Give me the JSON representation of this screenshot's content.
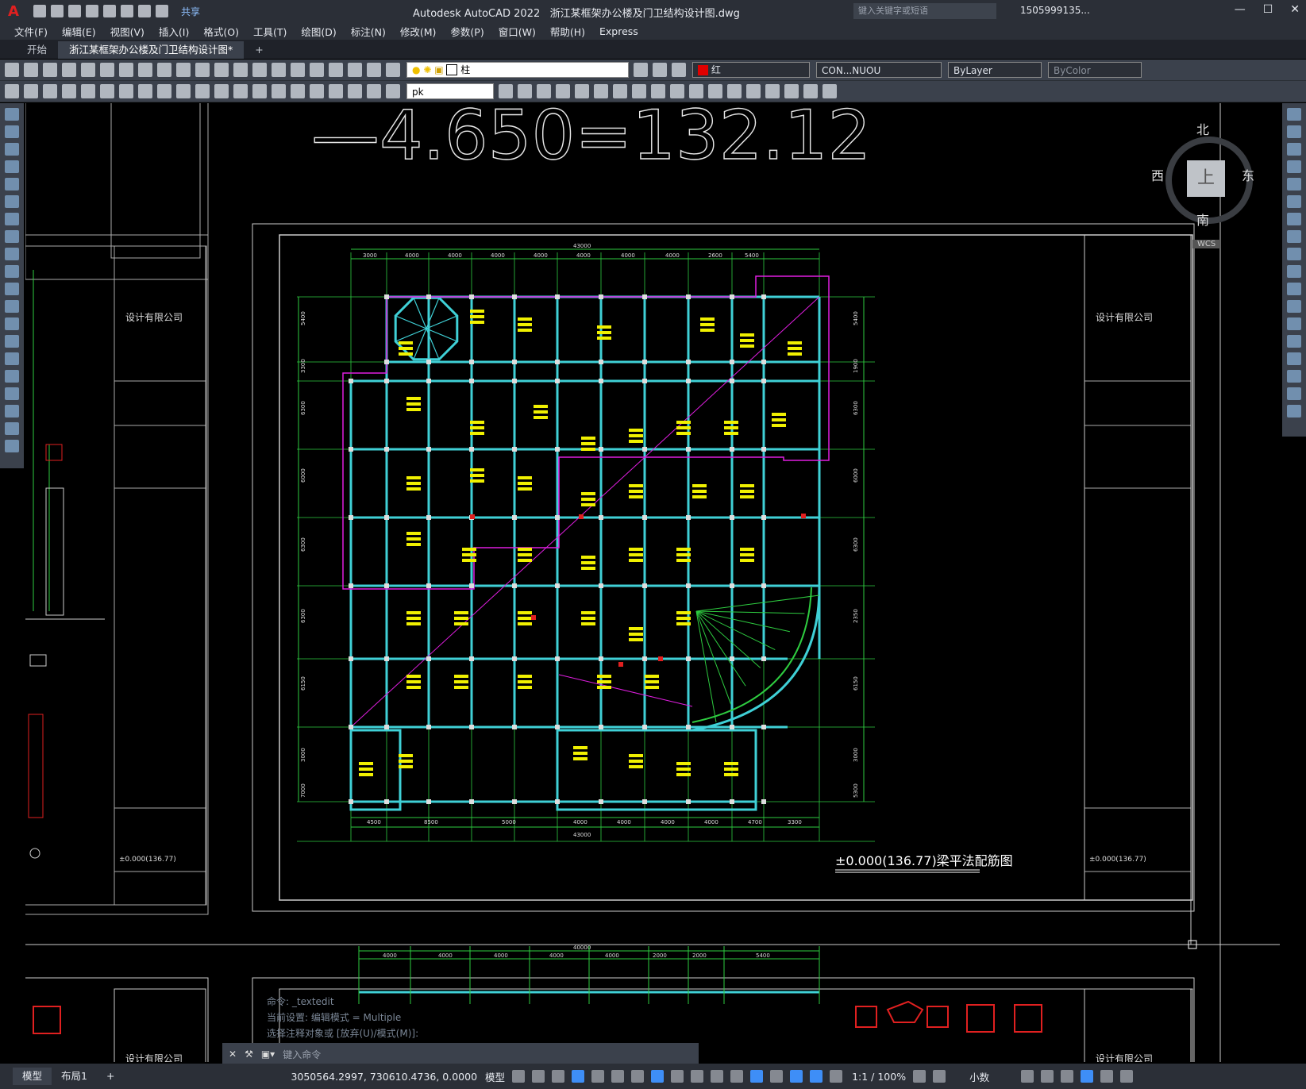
{
  "app": {
    "logo": "A",
    "title": "Autodesk AutoCAD 2022",
    "document": "浙江某框架办公楼及门卫结构设计图.dwg",
    "share_label": "共享",
    "search_placeholder": "键入关键字或短语",
    "user": "1505999135...",
    "window_controls": [
      "minimize-icon",
      "maximize-icon",
      "close-icon"
    ]
  },
  "menu": [
    "文件(F)",
    "编辑(E)",
    "视图(V)",
    "插入(I)",
    "格式(O)",
    "工具(T)",
    "绘图(D)",
    "标注(N)",
    "修改(M)",
    "参数(P)",
    "窗口(W)",
    "帮助(H)",
    "Express"
  ],
  "file_tabs": [
    "开始",
    "浙江某框架办公楼及门卫结构设计图*"
  ],
  "properties_bar": {
    "layer": "柱",
    "color": "红",
    "linetype": "CON...NUOU",
    "lineweight": "ByLayer",
    "plotstyle": "ByColor",
    "text_style": "pk"
  },
  "viewcube": {
    "north": "北",
    "south": "南",
    "west": "西",
    "east": "东",
    "face": "上",
    "wcs": "WCS"
  },
  "drawing": {
    "big_text": "—4.650=132.12",
    "company_left": "设计有限公司",
    "company_right": "设计有限公司",
    "company_bottom": "设计有限公司",
    "plan_title": "±0.000(136.77)梁平法配筋图",
    "sheet_label": "±0.000(136.77)",
    "overall_dim": "43000",
    "top_dims": [
      "3000",
      "4000",
      "4000",
      "4000",
      "4000",
      "4000",
      "4000",
      "4000",
      "2600",
      "5400"
    ],
    "bottom_dims": [
      "4500",
      "8500",
      "5000",
      "4000",
      "4000",
      "4000",
      "4000",
      "4700",
      "3300"
    ],
    "bottom_overall": "43000",
    "left_dims": [
      "5400",
      "3300",
      "6300",
      "6000",
      "6300",
      "6300",
      "6150",
      "3000",
      "7000"
    ],
    "right_dims": [
      "5400",
      "1900",
      "6300",
      "6000",
      "6300",
      "2350",
      "6150",
      "3000",
      "5300"
    ],
    "sub_top_overall": "40000",
    "sub_top_dims": [
      "4000",
      "4000",
      "4000",
      "4000",
      "4000",
      "2000",
      "2000",
      "5400"
    ]
  },
  "command": {
    "history": [
      "命令: _textedit",
      "当前设置: 编辑模式 = Multiple",
      "选择注释对象或 [放弃(U)/模式(M)]:"
    ],
    "placeholder": "键入命令"
  },
  "status": {
    "layouts": [
      "模型",
      "布局1"
    ],
    "coords": "3050564.2997, 730610.4736, 0.0000",
    "mode": "模型",
    "scale": "1:1 / 100%",
    "units": "小数"
  },
  "colors": {
    "accent": "#3e8ef7",
    "beam": "#3fd0d6",
    "axis": "#2ecc40",
    "magenta": "#e01ee0",
    "text_yellow": "#f0f000",
    "red": "#e02020"
  }
}
